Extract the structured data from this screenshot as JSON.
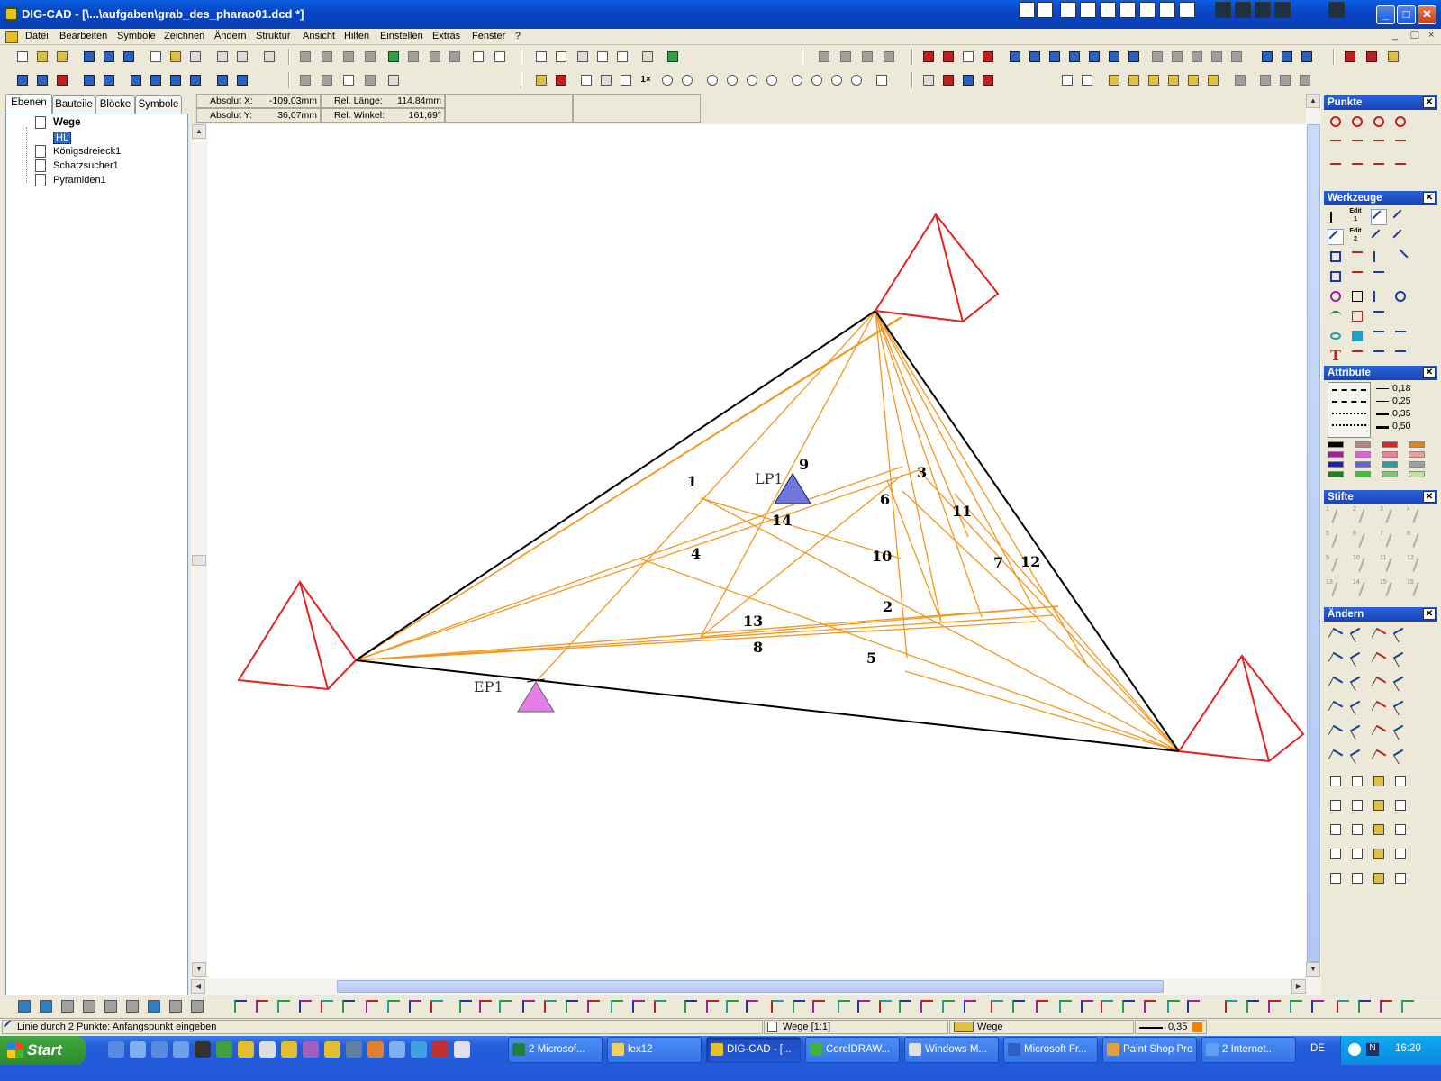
{
  "window": {
    "title": "DIG-CAD - [\\...\\aufgaben\\grab_des_pharao01.dcd *]",
    "min": "_",
    "max": "□",
    "close": "✕"
  },
  "menu": [
    "Datei",
    "Bearbeiten",
    "Symbole",
    "Zeichnen",
    "Ändern",
    "Struktur",
    "Ansicht",
    "Hilfen",
    "Einstellen",
    "Extras",
    "Fenster",
    "?"
  ],
  "mdi_controls": {
    "min": "_",
    "restore": "❐",
    "close": "×"
  },
  "coords": {
    "abs_x_label": "Absolut X:",
    "abs_x": "-109,03mm",
    "abs_y_label": "Absolut Y:",
    "abs_y": "36,07mm",
    "rel_len_label": "Rel. Länge:",
    "rel_len": "114,84mm",
    "rel_ang_label": "Rel. Winkel:",
    "rel_ang": "161,69°"
  },
  "left_tabs": [
    "Ebenen",
    "Bauteile",
    "Blöcke",
    "Symbole"
  ],
  "tree": {
    "root": "Wege",
    "selected": "HL",
    "items": [
      "Königsdreieck1",
      "Schatzsucher1",
      "Pyramiden1"
    ],
    "icon_letters": "BS"
  },
  "drawing": {
    "labels": {
      "lp": "LP1",
      "ep": "EP1"
    },
    "region_numbers": [
      "1",
      "2",
      "3",
      "4",
      "5",
      "6",
      "7",
      "8",
      "9",
      "10",
      "11",
      "12",
      "13",
      "14"
    ],
    "colors": {
      "triangle": "#000000",
      "pyramid": "#e82020",
      "construction": "#f5961e",
      "lp_marker": "#6f78d8",
      "ep_marker": "#e57ee8"
    }
  },
  "right_panels": {
    "punkte": "Punkte",
    "werkzeuge": "Werkzeuge",
    "attribute": "Attribute",
    "stifte": "Stifte",
    "aendern": "Ändern",
    "pen_widths": [
      "0,18",
      "0,25",
      "0,35",
      "0,50"
    ],
    "edit1": "Edit 1",
    "edit2": "Edit 2",
    "text_tool": "T",
    "stifte_numbers": [
      "1",
      "2",
      "3",
      "4",
      "5",
      "6",
      "7",
      "8",
      "9",
      "10",
      "11",
      "12",
      "13",
      "14",
      "15",
      "16"
    ],
    "palette": [
      "#000000",
      "#c08080",
      "#e82020",
      "#f08000",
      "#a020a0",
      "#e060e0",
      "#f080a0",
      "#e8a0a0",
      "#2020c0",
      "#6060e0",
      "#20a0a0",
      "#a0a0a0",
      "#208020",
      "#40c040",
      "#80c080",
      "#c0e0a0"
    ]
  },
  "status": {
    "hint": "Linie durch 2 Punkte: Anfangspunkt eingeben",
    "layer": "Wege [1:1]",
    "block": "Wege",
    "pen": "0,35",
    "pen_color": "#f08000"
  },
  "taskbar": {
    "start": "Start",
    "tasks": [
      "2 Microsof...",
      "lex12",
      "DIG-CAD - [...",
      "CorelDRAW...",
      "Windows M...",
      "Microsoft Fr...",
      "Paint Shop Pro",
      "2 Internet..."
    ],
    "lang": "DE",
    "time": "16:20"
  },
  "toolbar_misc": {
    "zoom_1x": "1×"
  }
}
